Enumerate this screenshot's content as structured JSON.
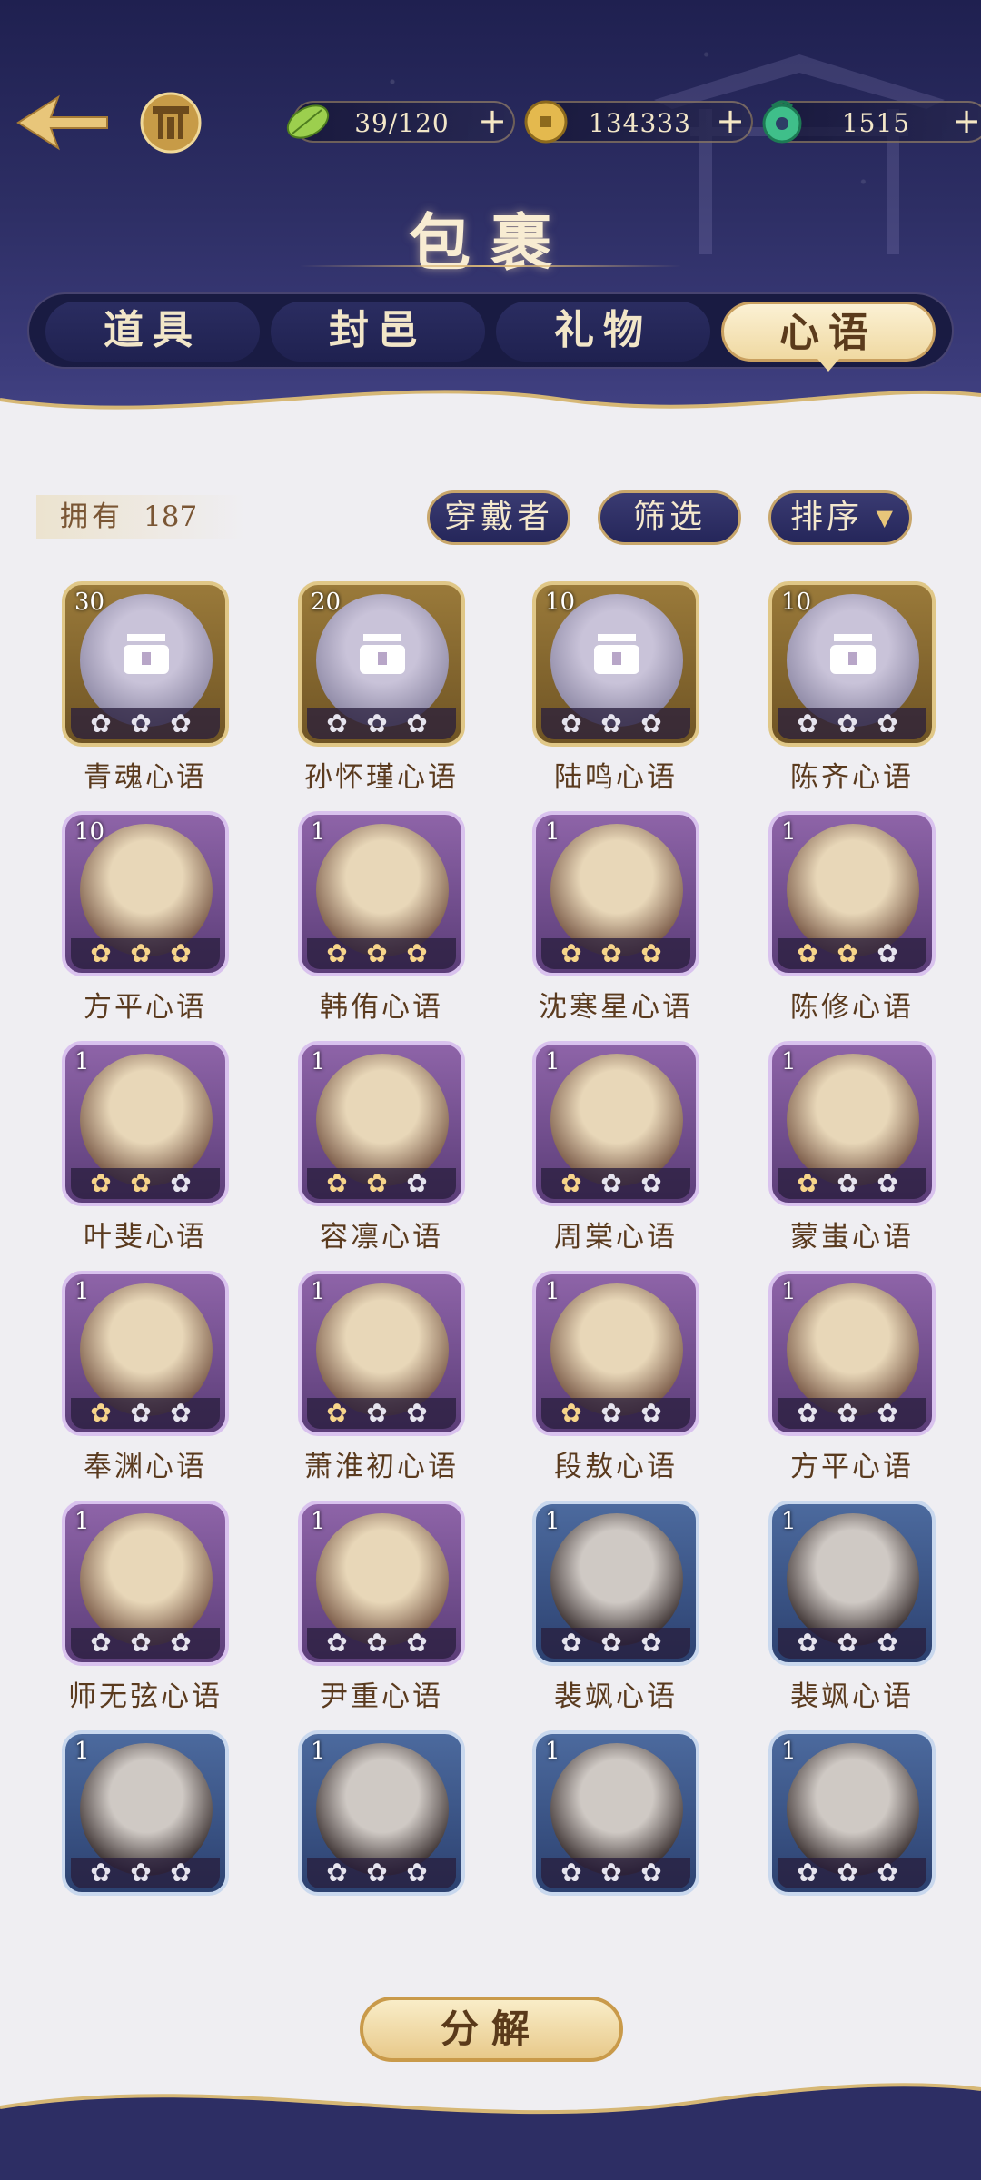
{
  "header": {
    "title": "包裹",
    "resources": [
      {
        "icon": "leaf-stamina-icon",
        "value": "39/120"
      },
      {
        "icon": "gold-coin-icon",
        "value": "134333"
      },
      {
        "icon": "jade-gem-icon",
        "value": "1515"
      }
    ],
    "plus_label": "+",
    "tabs": [
      {
        "label": "道具",
        "active": false
      },
      {
        "label": "封邑",
        "active": false
      },
      {
        "label": "礼物",
        "active": false
      },
      {
        "label": "心语",
        "active": true
      }
    ]
  },
  "filters": {
    "owned_label": "拥有",
    "owned_count": "187",
    "wearer_label": "穿戴者",
    "filter_label": "筛选",
    "sort_label": "排序"
  },
  "items": [
    {
      "name": "青魂心语",
      "count": "30",
      "tier": "gold",
      "stars": 0,
      "locked": true
    },
    {
      "name": "孙怀瑾心语",
      "count": "20",
      "tier": "gold",
      "stars": 0,
      "locked": true
    },
    {
      "name": "陆鸣心语",
      "count": "10",
      "tier": "gold",
      "stars": 0,
      "locked": true
    },
    {
      "name": "陈齐心语",
      "count": "10",
      "tier": "gold",
      "stars": 0,
      "locked": true
    },
    {
      "name": "方平心语",
      "count": "10",
      "tier": "purple",
      "stars": 3
    },
    {
      "name": "韩侑心语",
      "count": "1",
      "tier": "purple",
      "stars": 3
    },
    {
      "name": "沈寒星心语",
      "count": "1",
      "tier": "purple",
      "stars": 3
    },
    {
      "name": "陈修心语",
      "count": "1",
      "tier": "purple",
      "stars": 2
    },
    {
      "name": "叶斐心语",
      "count": "1",
      "tier": "purple",
      "stars": 2
    },
    {
      "name": "容凛心语",
      "count": "1",
      "tier": "purple",
      "stars": 2
    },
    {
      "name": "周棠心语",
      "count": "1",
      "tier": "purple",
      "stars": 1
    },
    {
      "name": "蒙蚩心语",
      "count": "1",
      "tier": "purple",
      "stars": 1
    },
    {
      "name": "奉渊心语",
      "count": "1",
      "tier": "purple",
      "stars": 1
    },
    {
      "name": "萧淮初心语",
      "count": "1",
      "tier": "purple",
      "stars": 1
    },
    {
      "name": "段敖心语",
      "count": "1",
      "tier": "purple",
      "stars": 1
    },
    {
      "name": "方平心语",
      "count": "1",
      "tier": "purple",
      "stars": 0
    },
    {
      "name": "师无弦心语",
      "count": "1",
      "tier": "purple",
      "stars": 0
    },
    {
      "name": "尹重心语",
      "count": "1",
      "tier": "purple",
      "stars": 0
    },
    {
      "name": "裴飒心语",
      "count": "1",
      "tier": "blue",
      "stars": 0
    },
    {
      "name": "裴飒心语",
      "count": "1",
      "tier": "blue",
      "stars": 0
    },
    {
      "name": "",
      "count": "1",
      "tier": "blue",
      "stars": 0
    },
    {
      "name": "",
      "count": "1",
      "tier": "blue",
      "stars": 0
    },
    {
      "name": "",
      "count": "1",
      "tier": "blue",
      "stars": 0
    },
    {
      "name": "",
      "count": "1",
      "tier": "blue",
      "stars": 0
    }
  ],
  "decompose_label": "分解",
  "colors": {
    "header_bg": "#2d2e64",
    "gold_frame": "#e0c787",
    "purple_frame": "#d9c2ee",
    "blue_frame": "#c9d8ee",
    "accent": "#f0d9a2"
  }
}
